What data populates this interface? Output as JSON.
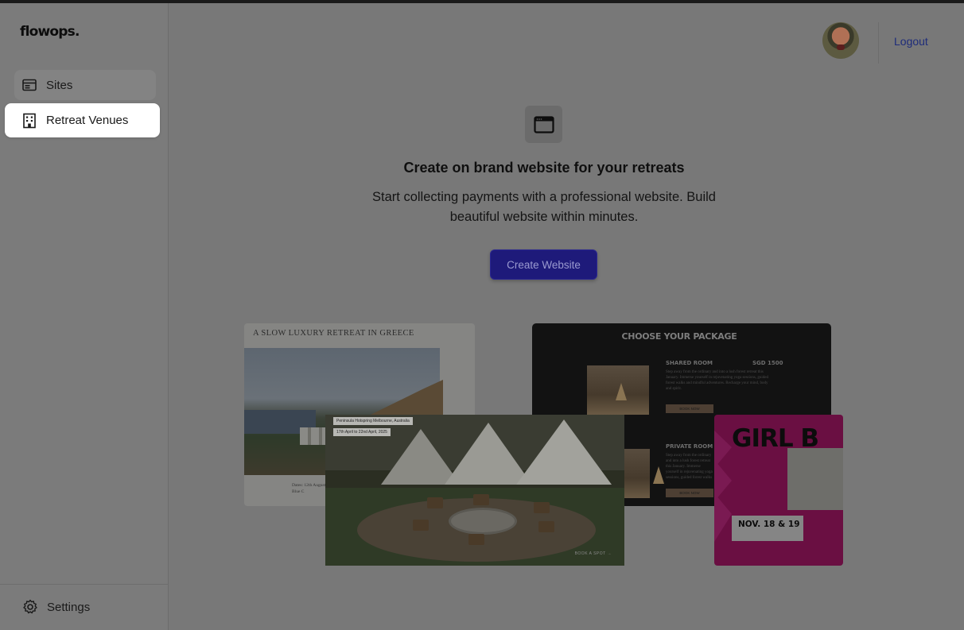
{
  "brand": {
    "logo": "flowops."
  },
  "sidebar": {
    "items": [
      {
        "label": "Sites",
        "icon": "browser-window-icon"
      },
      {
        "label": "Retreat Venues",
        "icon": "building-icon",
        "active": true
      }
    ],
    "settings": {
      "label": "Settings",
      "icon": "gear-icon"
    }
  },
  "header": {
    "logout_label": "Logout"
  },
  "empty_state": {
    "icon": "browser-window-icon",
    "title": "Create on brand website for your retreats",
    "subtitle_line1": "Start collecting payments with a professional website. Build",
    "subtitle_line2": "beautiful website within minutes.",
    "cta_label": "Create Website"
  },
  "previews": {
    "greece": {
      "title": "A SLOW LUXURY RETREAT IN GREECE",
      "footer_line1": "Dates: 12th August",
      "footer_line2": "Blue C"
    },
    "package": {
      "title": "CHOOSE YOUR PACKAGE",
      "shared_label": "SHARED ROOM",
      "shared_price": "SGD 1500",
      "shared_text": "Step away from the ordinary and into a lush forest retreat this January. Immerse yourself in rejuvenating yoga sessions, guided forest walks and mindful adventures. Recharge your mind, body and spirit.",
      "private_label": "PRIVATE ROOM",
      "private_text": "Step away from the ordinary and into a lush forest retreat this January. Immerse yourself in rejuvenating yoga sessions, guided forest walks and mindful adventures. Recharge your mind, body and spirit.",
      "book_label": "BOOK NOW"
    },
    "camp": {
      "location": "Peninsula Hotspring Melbourne, Australia",
      "dates": "17th April to 22nd April, 2025",
      "book_label": "BOOK A SPOT →"
    },
    "girl": {
      "title": "GIRL B",
      "date": "NOV. 18 & 19"
    }
  },
  "colors": {
    "overlay_bg": "#787878",
    "cta_bg": "#1e1a7a",
    "logout": "#1e2c7a",
    "active_nav_bg": "#ffffff"
  }
}
